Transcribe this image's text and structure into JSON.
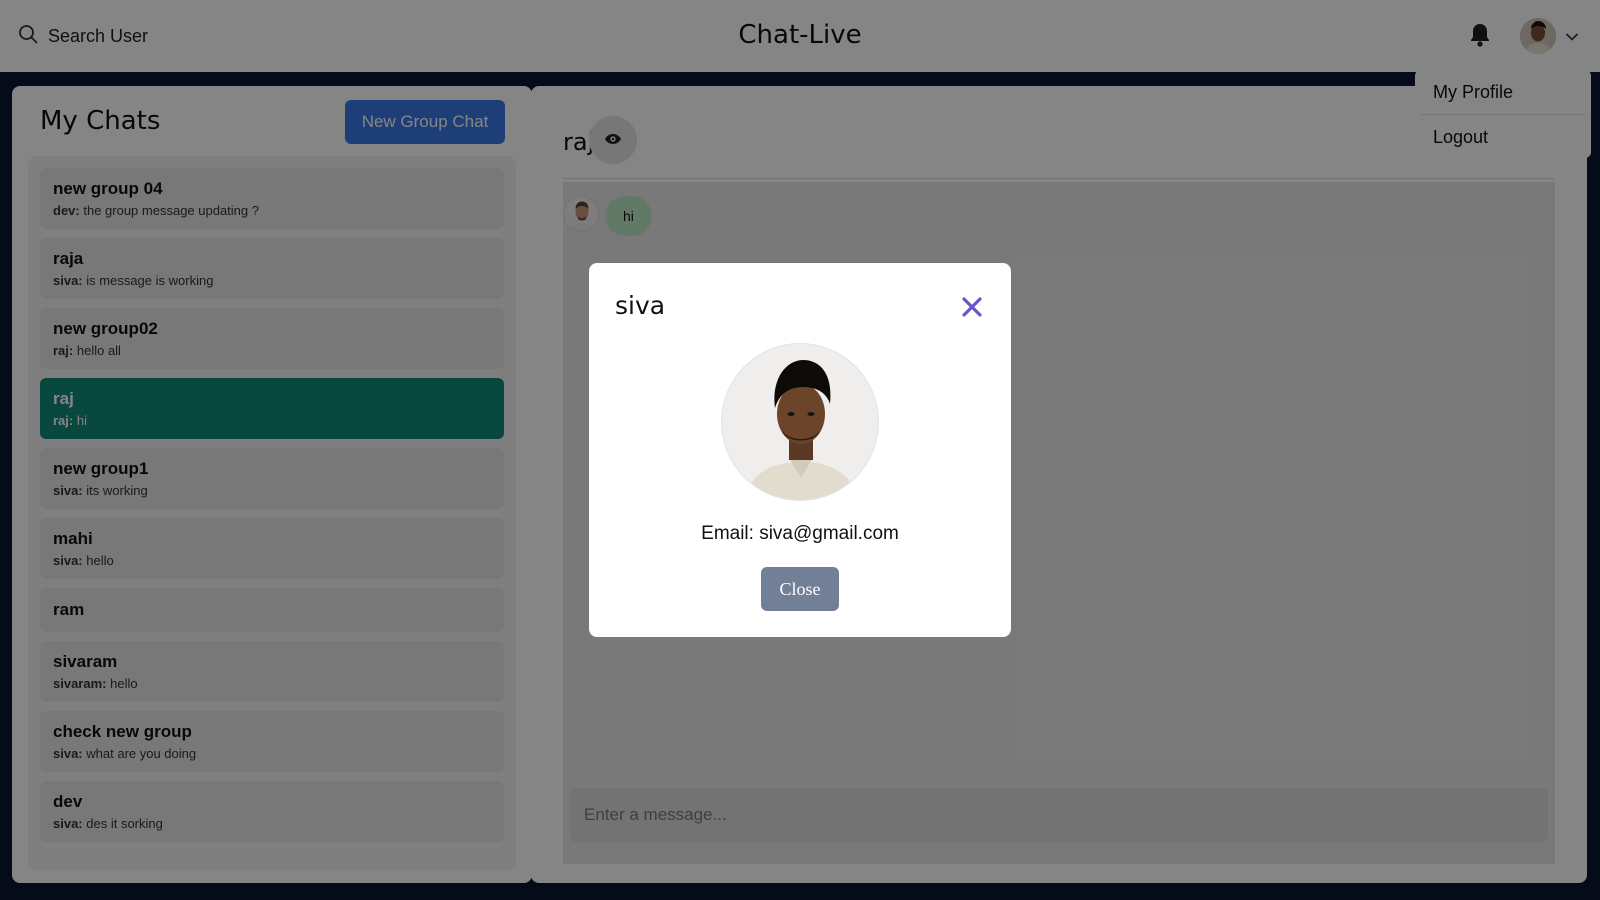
{
  "topbar": {
    "search_label": "Search User",
    "app_title": "Chat-Live"
  },
  "user_menu": {
    "items": [
      "My Profile",
      "Logout"
    ]
  },
  "chats": {
    "title": "My Chats",
    "new_group_label": "New Group Chat",
    "items": [
      {
        "name": "new group 04",
        "sender": "dev:",
        "message": "the group message updating ?"
      },
      {
        "name": "raja",
        "sender": "siva:",
        "message": "is message is working"
      },
      {
        "name": "new group02",
        "sender": "raj:",
        "message": "hello all"
      },
      {
        "name": "raj",
        "sender": "raj:",
        "message": "hi"
      },
      {
        "name": "new group1",
        "sender": "siva:",
        "message": "its working"
      },
      {
        "name": "mahi",
        "sender": "siva:",
        "message": "hello"
      },
      {
        "name": "ram",
        "sender": "",
        "message": ""
      },
      {
        "name": "sivaram",
        "sender": "sivaram:",
        "message": "hello"
      },
      {
        "name": "check new group",
        "sender": "siva:",
        "message": "what are you doing"
      },
      {
        "name": "dev",
        "sender": "siva:",
        "message": "des it sorking"
      }
    ]
  },
  "conversation": {
    "name": "raj",
    "messages": [
      {
        "text": "hi"
      }
    ],
    "input_placeholder": "Enter a message..."
  },
  "modal": {
    "title": "siva",
    "email_label": "Email:",
    "email": "siva@gmail.com",
    "email_text": "Email: siva@gmail.com",
    "close_label": "Close"
  },
  "colors": {
    "accent_blue": "#3b78e7",
    "active_chat": "#138a78",
    "message_bubble": "#bfe8c5",
    "close_x": "#6b55c8",
    "close_button": "#718096",
    "page_background": "#0c1630"
  },
  "icons": [
    "search-icon",
    "bell-icon",
    "chevron-down-icon",
    "eye-icon",
    "close-icon"
  ]
}
